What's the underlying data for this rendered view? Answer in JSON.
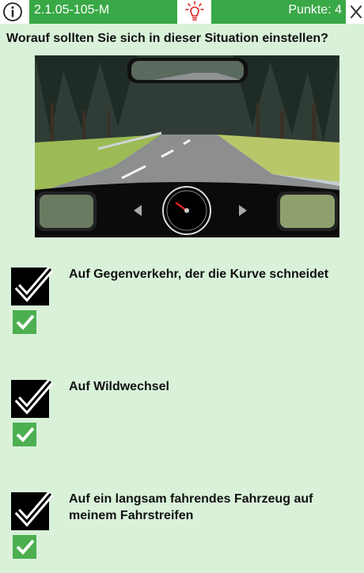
{
  "header": {
    "question_code": "2.1.05-105-M",
    "points_label": "Punkte: 4",
    "info_icon": "info-icon",
    "hint_icon": "lightbulb-icon",
    "close_icon": "close-icon"
  },
  "question": {
    "text": "Worauf sollten Sie sich in dieser Situation einstellen?"
  },
  "answers": [
    {
      "text": "Auf Gegenverkehr, der die Kurve schneidet",
      "selected": true,
      "correct": true
    },
    {
      "text": "Auf Wildwechsel",
      "selected": true,
      "correct": true
    },
    {
      "text": "Auf ein langsam fahrendes Fahrzeug auf meinem Fahrstreifen",
      "selected": true,
      "correct": true
    }
  ],
  "colors": {
    "accent_green": "#39a846",
    "background": "#d9f1d9",
    "hint_red": "#e02020",
    "check_green": "#4caf50"
  }
}
